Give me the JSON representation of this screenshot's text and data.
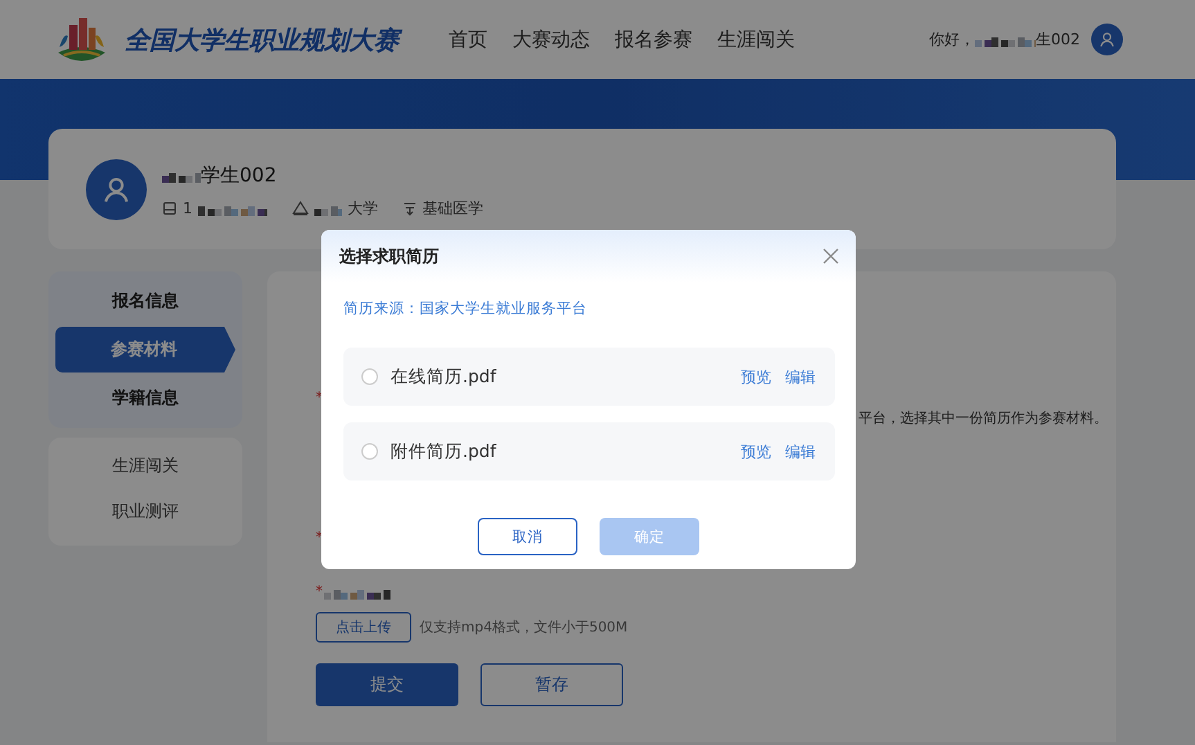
{
  "header": {
    "site_title": "全国大学生职业规划大赛",
    "nav": [
      {
        "label": "首页"
      },
      {
        "label": "大赛动态"
      },
      {
        "label": "报名参赛"
      },
      {
        "label": "生涯闯关"
      }
    ],
    "greeting": "你好，",
    "user_suffix": "生002"
  },
  "profile": {
    "name_suffix": "学生002",
    "id_prefix": "1",
    "school_suffix": "大学",
    "major": "基础医学"
  },
  "sidebar": {
    "groups": [
      {
        "items": [
          {
            "label": "报名信息",
            "selected": false
          },
          {
            "label": "参赛材料",
            "selected": true
          },
          {
            "label": "学籍信息",
            "selected": false
          }
        ]
      },
      {
        "items": [
          {
            "label": "生涯闯关",
            "selected": false
          },
          {
            "label": "职业测评",
            "selected": false
          }
        ]
      }
    ]
  },
  "content": {
    "required_marks": [
      "*",
      "*",
      "*"
    ],
    "resume_hint_tail": "平台，选择其中一份简历作为参赛材料。",
    "upload_button": "点击上传",
    "upload_hint": "仅支持mp4格式，文件小于500M",
    "submit": "提交",
    "save_draft": "暂存"
  },
  "dialog": {
    "title": "选择求职简历",
    "source": "简历来源：国家大学生就业服务平台",
    "resumes": [
      {
        "file": "在线简历.pdf",
        "selected": false,
        "actions": [
          "预览",
          "编辑"
        ]
      },
      {
        "file": "附件简历.pdf",
        "selected": false,
        "actions": [
          "预览",
          "编辑"
        ]
      }
    ],
    "cancel": "取消",
    "confirm": {
      "label": "确定",
      "disabled": true
    }
  }
}
